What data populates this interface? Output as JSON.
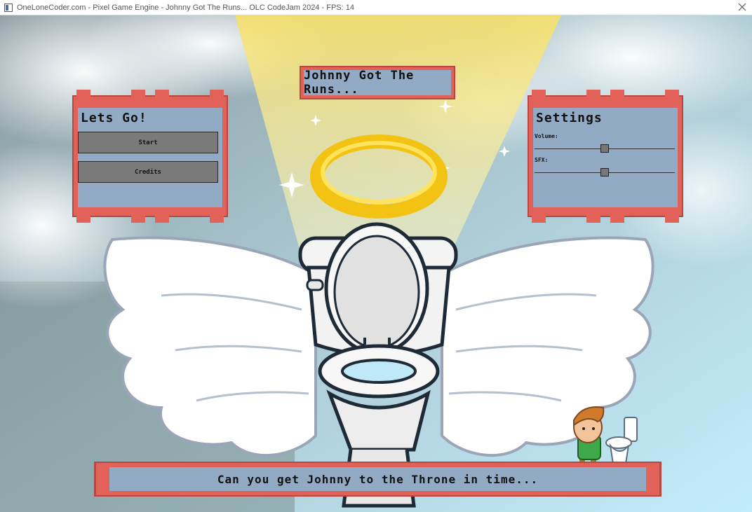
{
  "window": {
    "title": "OneLoneCoder.com - Pixel Game Engine - Johnny Got The Runs... OLC CodeJam 2024 - FPS: 14",
    "close_icon": "close-icon"
  },
  "game": {
    "title": "Johnny Got The Runs...",
    "tagline": "Can you get Johnny to the Throne in time...",
    "menu": {
      "heading": "Lets Go!",
      "start_label": "Start",
      "credits_label": "Credits"
    },
    "settings": {
      "heading": "Settings",
      "volume_label": "Volume:",
      "volume_level": 0.5,
      "sfx_label": "SFX:",
      "sfx_level": 0.5
    }
  },
  "colors": {
    "panel_frame": "#e2625a",
    "panel_frame_dark": "#b64842",
    "panel_inner": "#93aac4",
    "halo": "#f6cf13",
    "sky": "#bfe4f2"
  }
}
